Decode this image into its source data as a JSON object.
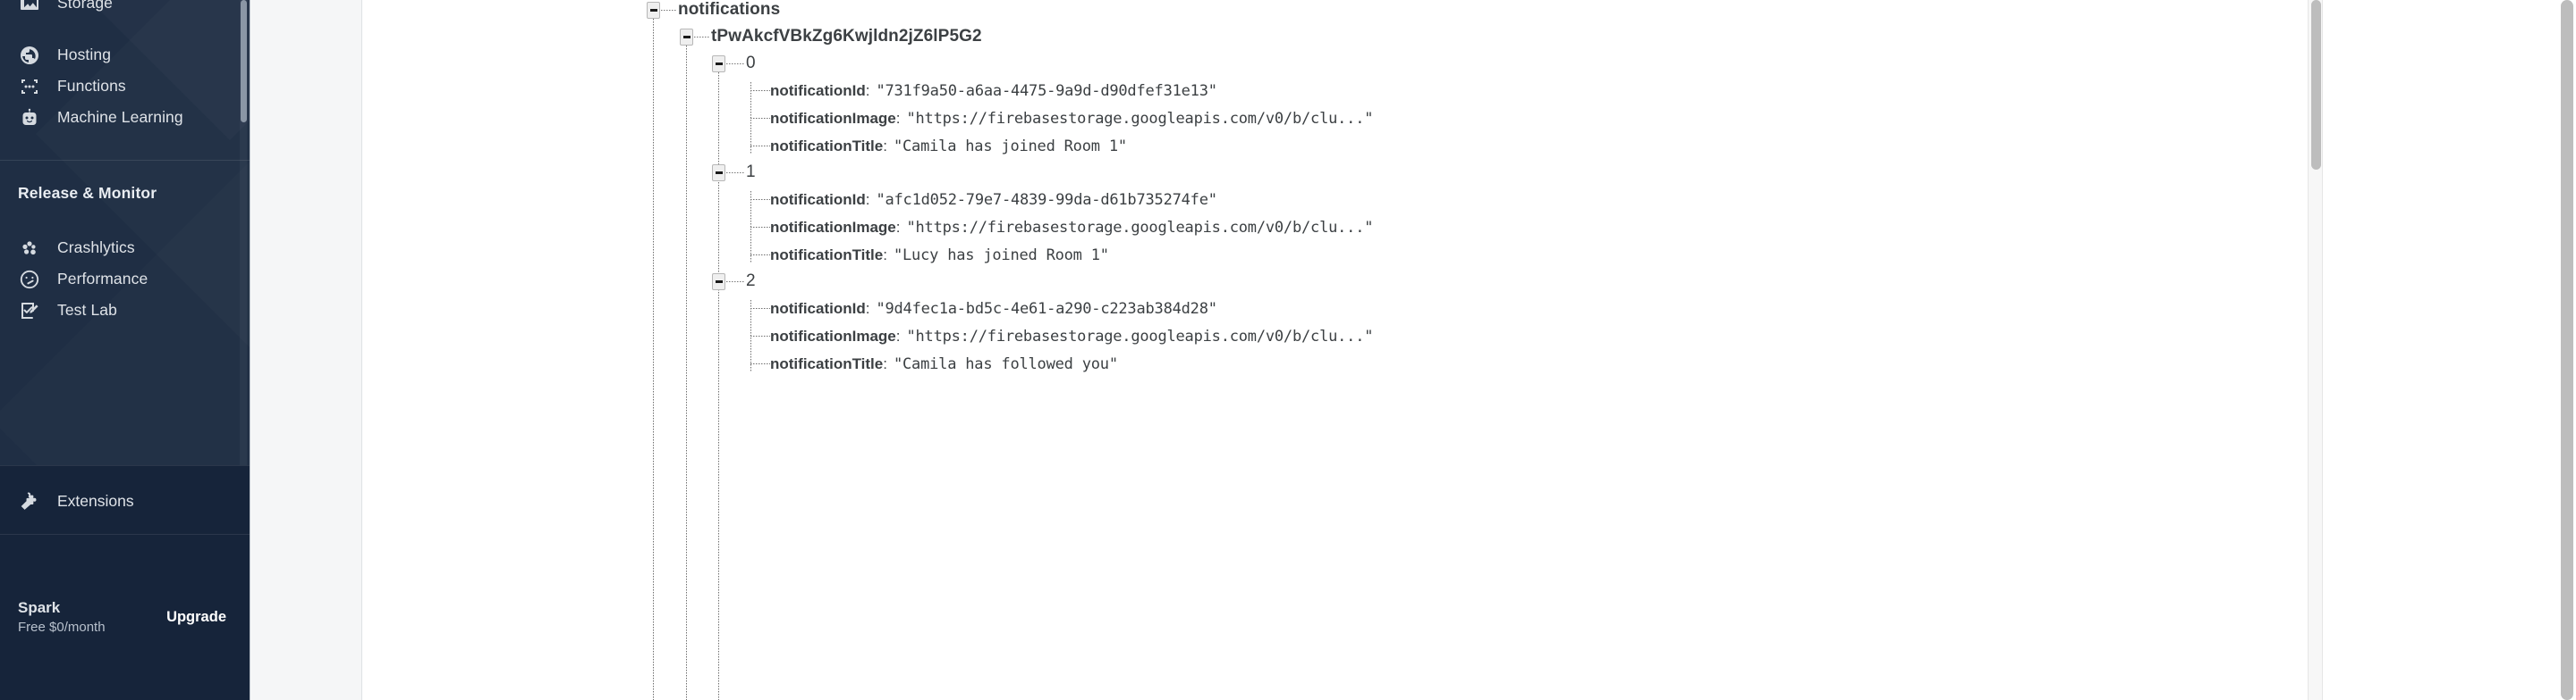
{
  "sidebar": {
    "nav_items": [
      {
        "label": "Storage",
        "icon": "image-storage-icon"
      },
      {
        "label": "Hosting",
        "icon": "globe-hosting-icon"
      },
      {
        "label": "Functions",
        "icon": "functions-brackets-icon"
      },
      {
        "label": "Machine Learning",
        "icon": "robot-ml-icon"
      }
    ],
    "group_title": "Release & Monitor",
    "group_items": [
      {
        "label": "Crashlytics",
        "icon": "crashlytics-icon"
      },
      {
        "label": "Performance",
        "icon": "performance-gauge-icon"
      },
      {
        "label": "Test Lab",
        "icon": "test-lab-icon"
      }
    ],
    "pinned": {
      "label": "Extensions",
      "icon": "extensions-puzzle-icon"
    },
    "plan": {
      "name": "Spark",
      "price": "Free $0/month",
      "upgrade_label": "Upgrade"
    }
  },
  "tree": {
    "root_label": "notifications",
    "user_key": "tPwAkcfVBkZg6Kwjldn2jZ6lP5G2",
    "items": [
      {
        "index": "0",
        "fields": [
          {
            "key": "notificationId",
            "value": "\"731f9a50-a6aa-4475-9a9d-d90dfef31e13\""
          },
          {
            "key": "notificationImage",
            "value": "\"https://firebasestorage.googleapis.com/v0/b/clu...\""
          },
          {
            "key": "notificationTitle",
            "value": "\"Camila has joined Room 1\""
          }
        ]
      },
      {
        "index": "1",
        "fields": [
          {
            "key": "notificationId",
            "value": "\"afc1d052-79e7-4839-99da-d61b735274fe\""
          },
          {
            "key": "notificationImage",
            "value": "\"https://firebasestorage.googleapis.com/v0/b/clu...\""
          },
          {
            "key": "notificationTitle",
            "value": "\"Lucy has joined Room 1\""
          }
        ]
      },
      {
        "index": "2",
        "fields": [
          {
            "key": "notificationId",
            "value": "\"9d4fec1a-bd5c-4e61-a290-c223ab384d28\""
          },
          {
            "key": "notificationImage",
            "value": "\"https://firebasestorage.googleapis.com/v0/b/clu...\""
          },
          {
            "key": "notificationTitle",
            "value": "\"Camila has followed you\""
          }
        ]
      }
    ]
  },
  "colors": {
    "sidebar_bg": "#1f2e44",
    "sidebar_footer_bg": "#16243a",
    "content_bg": "#ffffff",
    "gutter_bg": "#f5f6f7",
    "text_primary": "#3c4043",
    "scrollbar_thumb": "#bdbdbd"
  }
}
